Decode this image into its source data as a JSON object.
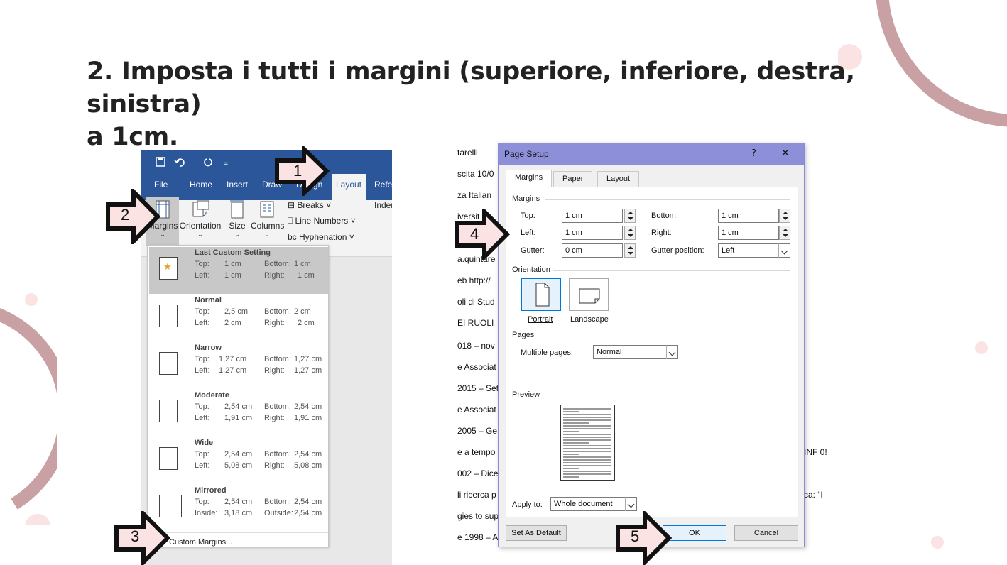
{
  "title_line1": "2. Imposta i tutti i margini (superiore, inferiore, destra, sinistra)",
  "title_line2": "a 1cm.",
  "ribbon": {
    "tabs": [
      "File",
      "Home",
      "Insert",
      "Draw",
      "Design",
      "Layout",
      "Refe"
    ],
    "active_tab": "Layout",
    "buttons": {
      "margins": "Margins",
      "orientation": "Orientation",
      "size": "Size",
      "columns": "Columns"
    },
    "small": {
      "breaks": "Breaks",
      "line_numbers": "Line Numbers",
      "hyphenation": "Hyphenation",
      "indent": "Inder"
    }
  },
  "margins_menu": {
    "items": [
      {
        "name": "Last Custom Setting",
        "l1a": "Top:",
        "l1b": "1 cm",
        "l1c": "Bottom:",
        "l1d": "1 cm",
        "l2a": "Left:",
        "l2b": "1 cm",
        "l2c": "Right:",
        "l2d": "1 cm"
      },
      {
        "name": "Normal",
        "l1a": "Top:",
        "l1b": "2,5 cm",
        "l1c": "Bottom:",
        "l1d": "2 cm",
        "l2a": "Left:",
        "l2b": "2 cm",
        "l2c": "Right:",
        "l2d": "2 cm"
      },
      {
        "name": "Narrow",
        "l1a": "Top:",
        "l1b": "1,27 cm",
        "l1c": "Bottom:",
        "l1d": "1,27 cm",
        "l2a": "Left:",
        "l2b": "1,27 cm",
        "l2c": "Right:",
        "l2d": "1,27 cm"
      },
      {
        "name": "Moderate",
        "l1a": "Top:",
        "l1b": "2,54 cm",
        "l1c": "Bottom:",
        "l1d": "2,54 cm",
        "l2a": "Left:",
        "l2b": "1,91 cm",
        "l2c": "Right:",
        "l2d": "1,91 cm"
      },
      {
        "name": "Wide",
        "l1a": "Top:",
        "l1b": "2,54 cm",
        "l1c": "Bottom:",
        "l1d": "2,54 cm",
        "l2a": "Left:",
        "l2b": "5,08 cm",
        "l2c": "Right:",
        "l2d": "5,08 cm"
      },
      {
        "name": "Mirrored",
        "l1a": "Top:",
        "l1b": "2,54 cm",
        "l1c": "Bottom:",
        "l1d": "2,54 cm",
        "l2a": "Inside:",
        "l2b": "3,18 cm",
        "l2c": "Outside:",
        "l2d": "2,54 cm"
      }
    ],
    "custom": "Custom Margins..."
  },
  "doc_lines": [
    "tarelli",
    "scita 10/0",
    "za Italian",
    "iversit",
    "",
    "a.quintare",
    "eb http://",
    "oli di Stud",
    "EI RUOLI",
    "018 – nov",
    "e Associat",
    "2015 – Set",
    "e Associat",
    "2005 – Ge",
    "e a tempo",
    "002 – Dice",
    "li ricerca p",
    "gies to sup",
    "e 1998 – A"
  ],
  "doc_right": [
    "INF 0!",
    "ca: “I"
  ],
  "dialog": {
    "title": "Page Setup",
    "help": "?",
    "close": "✕",
    "tabs": [
      "Margins",
      "Paper",
      "Layout"
    ],
    "margins_section": "Margins",
    "top_label": "Top:",
    "top_value": "1 cm",
    "bottom_label": "Bottom:",
    "bottom_value": "1 cm",
    "left_label": "Left:",
    "left_value": "1 cm",
    "right_label": "Right:",
    "right_value": "1 cm",
    "gutter_label": "Gutter:",
    "gutter_value": "0 cm",
    "gutter_pos_label": "Gutter position:",
    "gutter_pos_value": "Left",
    "orientation_section": "Orientation",
    "portrait": "Portrait",
    "landscape": "Landscape",
    "pages_section": "Pages",
    "multiple_pages_label": "Multiple pages:",
    "multiple_pages_value": "Normal",
    "preview_section": "Preview",
    "apply_label": "Apply to:",
    "apply_value": "Whole document",
    "default_button": "Set As Default",
    "ok_button": "OK",
    "cancel_button": "Cancel"
  },
  "callouts": [
    "1",
    "2",
    "3",
    "4",
    "5"
  ],
  "colors": {
    "ribbon_blue": "#2b579a",
    "dialog_title": "#8e8fd9",
    "deco": "#c9a0a3",
    "arrow_fill": "#fbe3e3"
  }
}
